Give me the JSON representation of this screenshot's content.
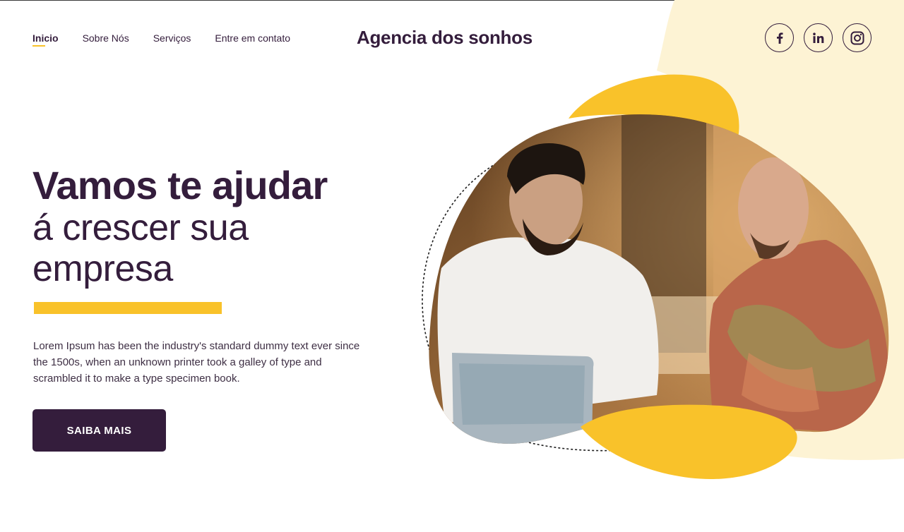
{
  "nav": {
    "items": [
      {
        "label": "Inicio",
        "active": true
      },
      {
        "label": "Sobre Nós",
        "active": false
      },
      {
        "label": "Serviços",
        "active": false
      },
      {
        "label": "Entre em contato",
        "active": false
      }
    ]
  },
  "brand": {
    "title": "Agencia dos sonhos"
  },
  "socials": [
    {
      "name": "facebook-icon"
    },
    {
      "name": "linkedin-icon"
    },
    {
      "name": "instagram-icon"
    }
  ],
  "hero": {
    "title_line1": "Vamos te ajudar",
    "title_line2": "á crescer sua",
    "title_line3": "empresa",
    "description": "Lorem Ipsum has been the industry's standard dummy text ever since the 1500s, when an unknown printer took a galley of type and scrambled it to make a type specimen book.",
    "cta_label": "SAIBA MAIS"
  },
  "colors": {
    "primary": "#341d3c",
    "accent": "#f9c22a",
    "accent_light": "#fdf3d4",
    "background": "#ffffff"
  },
  "image": {
    "subject": "photo-two-men-with-laptop"
  }
}
